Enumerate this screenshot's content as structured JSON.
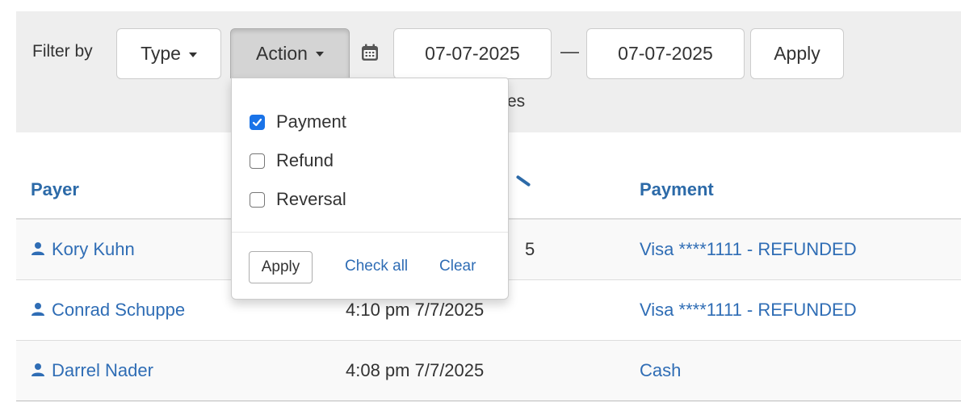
{
  "filter": {
    "label": "Filter by",
    "type_button": "Type",
    "action_button": "Action",
    "date_from": "07-07-2025",
    "date_separator": "—",
    "date_to": "07-07-2025",
    "apply_label": "Apply",
    "partial_text": "es"
  },
  "icons": {
    "calendar": "calendar-icon",
    "user": "user-icon",
    "caret": "caret-down-icon",
    "check": "checkmark-icon"
  },
  "action_dropdown": {
    "options": [
      {
        "label": "Payment",
        "checked": true
      },
      {
        "label": "Refund",
        "checked": false
      },
      {
        "label": "Reversal",
        "checked": false
      }
    ],
    "apply_label": "Apply",
    "check_all_label": "Check all",
    "clear_label": "Clear"
  },
  "table": {
    "headers": {
      "payer": "Payer",
      "payment": "Payment"
    },
    "rows": [
      {
        "payer": "Kory Kuhn",
        "time": "5",
        "payment": "Visa ****1111 - REFUNDED"
      },
      {
        "payer": "Conrad Schuppe",
        "time": "4:10 pm 7/7/2025",
        "payment": "Visa ****1111 - REFUNDED"
      },
      {
        "payer": "Darrel Nader",
        "time": "4:08 pm 7/7/2025",
        "payment": "Cash"
      }
    ]
  },
  "colors": {
    "link": "#2f6db5",
    "header_link": "#2c6aa8",
    "filter_bar_bg": "#eeeeee",
    "checkbox_checked": "#1a73e8",
    "row_stripe": "#f9f9f9"
  }
}
